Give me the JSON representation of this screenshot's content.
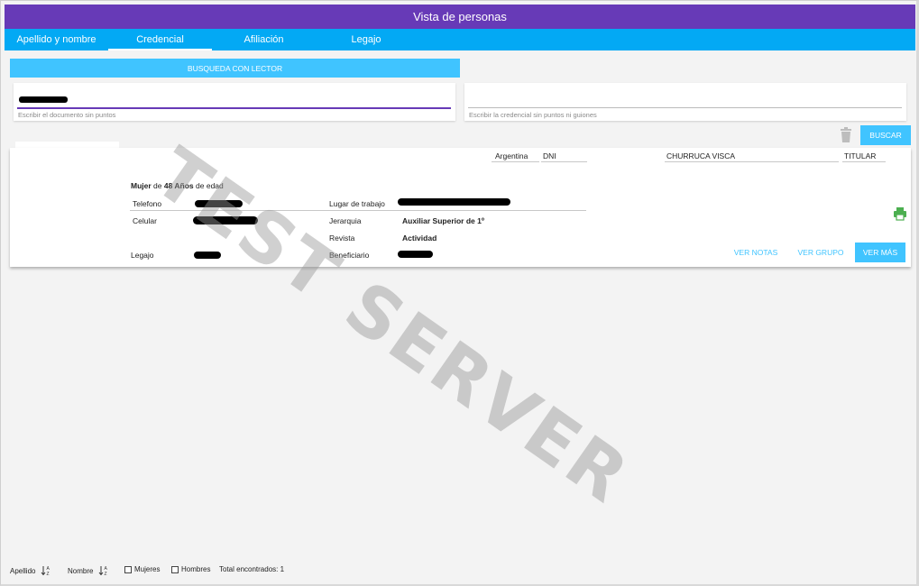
{
  "title": "Vista de personas",
  "tabs": [
    {
      "label": "Apellido y nombre"
    },
    {
      "label": "Credencial"
    },
    {
      "label": "Afiliación"
    },
    {
      "label": "Legajo"
    }
  ],
  "lector_button": "BUSQUEDA CON LECTOR",
  "documento_field": {
    "hint": "Escribir el documento sin puntos"
  },
  "credencial_field": {
    "hint": "Escribir la credencial sin puntos ni guiones"
  },
  "buscar_button": "BUSCAR",
  "person": {
    "country": "Argentina",
    "doc_type": "DNI",
    "surname": "CHURRUCA VISCA",
    "role": "TITULAR",
    "gender": "Mujer",
    "age_pre": "de",
    "age": "48 Años",
    "age_post": "de edad",
    "labels": {
      "telefono": "Telefono",
      "celular": "Celular",
      "legajo": "Legajo",
      "lugar_trabajo": "Lugar de trabajo",
      "jerarquia": "Jerarquia",
      "revista": "Revista",
      "beneficiario": "Beneficiario"
    },
    "jerarquia": "Auxiliar Superior de 1º",
    "revista": "Actividad"
  },
  "card_buttons": {
    "ver_notas": "VER NOTAS",
    "ver_grupo": "VER GRUPO",
    "ver_mas": "VER MÁS"
  },
  "watermark": "TEST SERVER",
  "footer": {
    "apellido": "Apellido",
    "nombre": "Nombre",
    "mujeres": "Mujeres",
    "hombres": "Hombres",
    "total": "Total encontrados: 1"
  },
  "colors": {
    "title_bar": "#673ab7",
    "tab_bar": "#03a9f4",
    "accent": "#40c4ff",
    "printer": "#4caf50"
  }
}
